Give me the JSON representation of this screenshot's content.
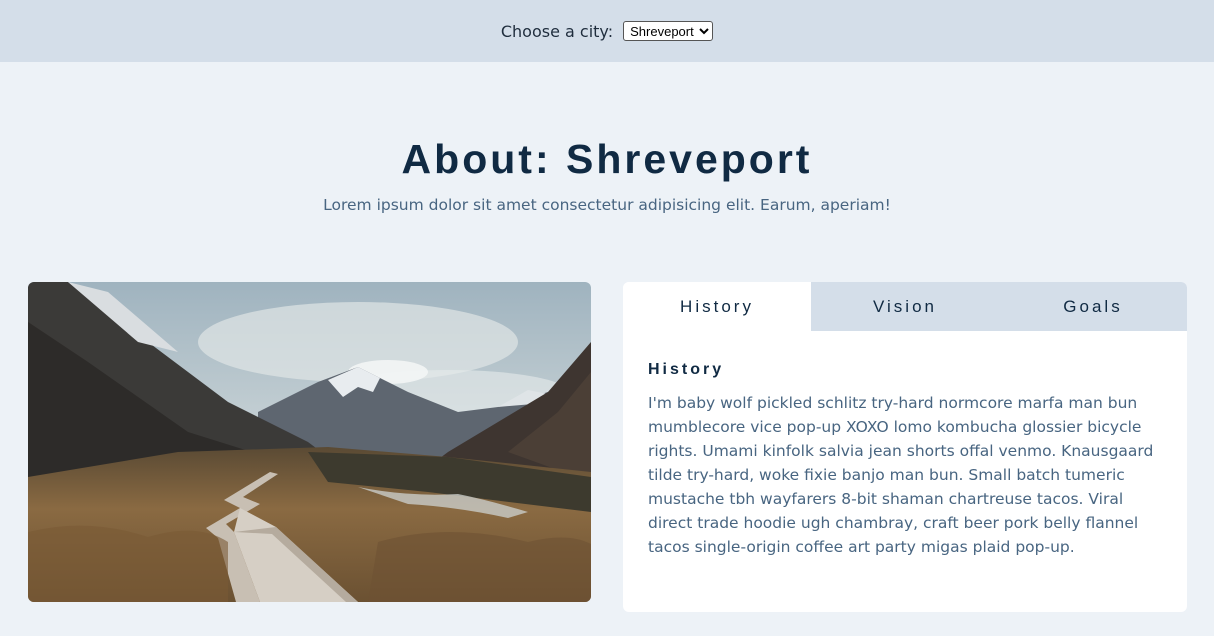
{
  "header": {
    "city_label": "Choose a city:",
    "city_selected": "Shreveport"
  },
  "hero": {
    "title": "About: Shreveport",
    "subtitle": "Lorem ipsum dolor sit amet consectetur adipisicing elit. Earum, aperiam!"
  },
  "image": {
    "description": "mountain-valley-boardwalk-photo"
  },
  "tabs": {
    "items": [
      {
        "label": "History",
        "active": true
      },
      {
        "label": "Vision",
        "active": false
      },
      {
        "label": "Goals",
        "active": false
      }
    ],
    "content": {
      "heading": "History",
      "text": "I'm baby wolf pickled schlitz try-hard normcore marfa man bun mumblecore vice pop-up XOXO lomo kombucha glossier bicycle rights. Umami kinfolk salvia jean shorts offal venmo. Knausgaard tilde try-hard, woke fixie banjo man bun. Small batch tumeric mustache tbh wayfarers 8-bit shaman chartreuse tacos. Viral direct trade hoodie ugh chambray, craft beer pork belly flannel tacos single-origin coffee art party migas plaid pop-up."
    }
  },
  "colors": {
    "page_bg": "#edf2f7",
    "header_bg": "#d4dee9",
    "title": "#102a43",
    "body_text": "#486581"
  }
}
